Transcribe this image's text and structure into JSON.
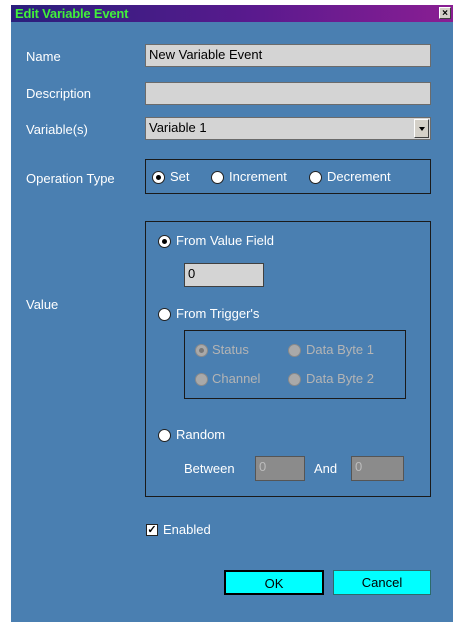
{
  "window": {
    "title": "Edit Variable Event",
    "close_glyph": "×"
  },
  "form": {
    "name_label": "Name",
    "name_value": "New Variable Event",
    "description_label": "Description",
    "description_value": "",
    "variables_label": "Variable(s)",
    "variables_selected": "Variable 1",
    "operation_label": "Operation Type",
    "operation_options": [
      "Set",
      "Increment",
      "Decrement"
    ],
    "operation_selected": "Set",
    "value_label": "Value"
  },
  "value": {
    "from_value_field_label": "From Value Field",
    "value_field": "0",
    "from_triggers_label": "From Trigger's",
    "trigger_options": [
      "Status",
      "Data Byte 1",
      "Channel",
      "Data Byte 2"
    ],
    "random_label": "Random",
    "between_label": "Between",
    "between_value": "0",
    "and_label": "And",
    "and_value": "0",
    "selected": "From Value Field"
  },
  "enabled": {
    "label": "Enabled",
    "checked": true,
    "check_glyph": "✓"
  },
  "buttons": {
    "ok": "OK",
    "cancel": "Cancel"
  }
}
